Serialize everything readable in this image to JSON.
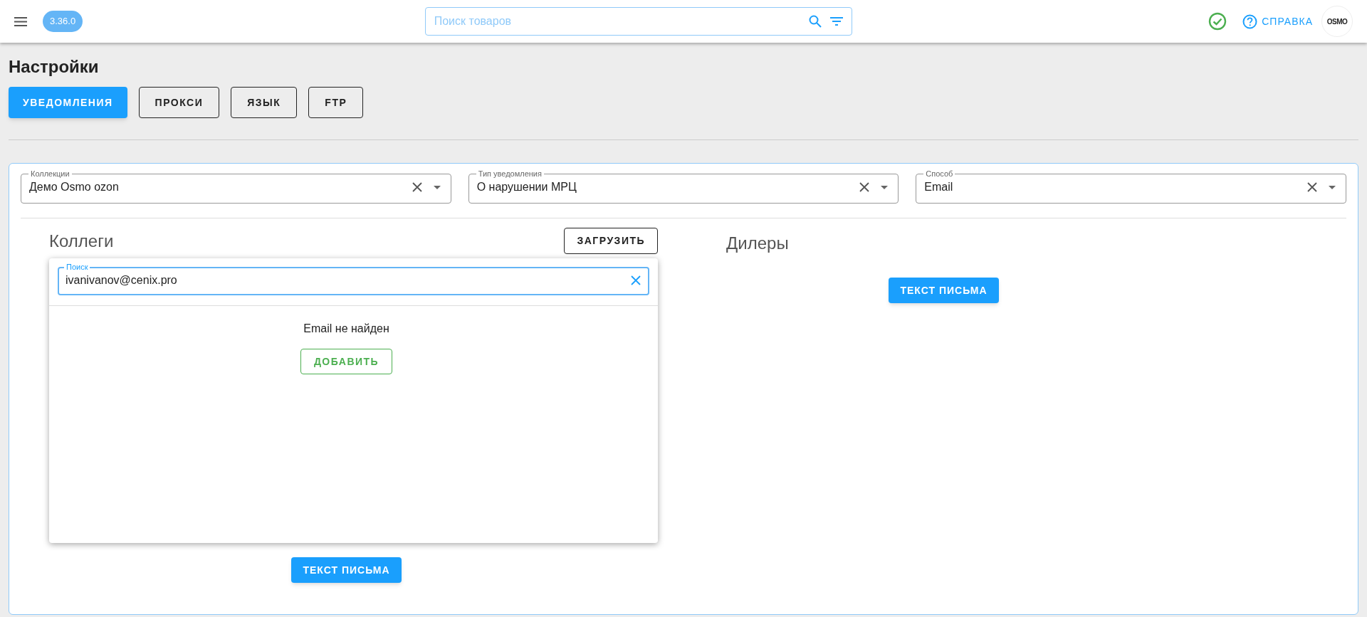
{
  "header": {
    "version": "3.36.0",
    "search": {
      "placeholder": "Поиск товаров"
    },
    "help": "СПРАВКА",
    "logo": "OSMO"
  },
  "title": "Настройки",
  "tabs": [
    {
      "label": "УВЕДОМЛЕНИЯ",
      "selected": true
    },
    {
      "label": "ПРОКСИ",
      "selected": false
    },
    {
      "label": "ЯЗЫК",
      "selected": false
    },
    {
      "label": "FTP",
      "selected": false
    }
  ],
  "filters": [
    {
      "label": "Коллекции",
      "value": "Демо Osmo ozon"
    },
    {
      "label": "Тип уведомления",
      "value": "О нарушении МРЦ"
    },
    {
      "label": "Способ",
      "value": "Email"
    }
  ],
  "colleagues": {
    "title": "Коллеги",
    "upload_button": "ЗАГРУЗИТЬ",
    "popup": {
      "search": {
        "label": "Поиск",
        "value": "ivanivanov@cenix.pro"
      },
      "message": "Email не найден",
      "add_button": "ДОБАВИТЬ"
    },
    "letter_button": "ТЕКСТ ПИСЬМА"
  },
  "dealers": {
    "title": "Дилеры",
    "letter_button": "ТЕКСТ ПИСЬМА"
  }
}
